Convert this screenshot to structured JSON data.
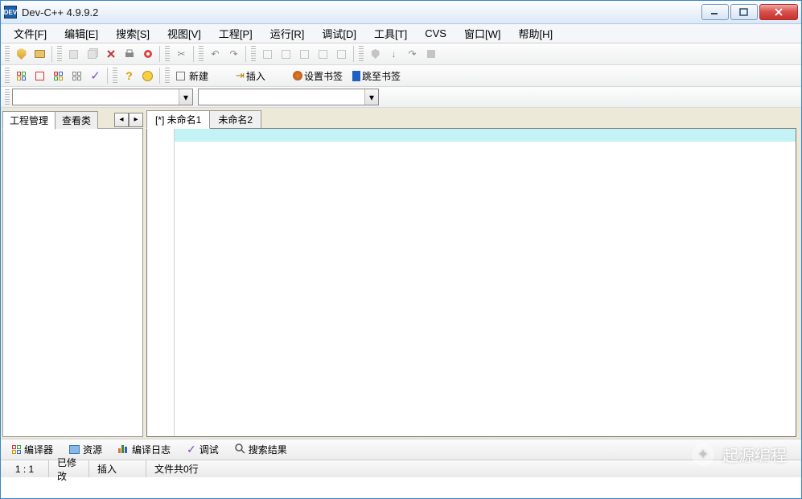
{
  "title": "Dev-C++ 4.9.9.2",
  "menu": [
    "文件[F]",
    "编辑[E]",
    "搜索[S]",
    "视图[V]",
    "工程[P]",
    "运行[R]",
    "调试[D]",
    "工具[T]",
    "CVS",
    "窗口[W]",
    "帮助[H]"
  ],
  "toolbar2": {
    "new_label": "新建",
    "insert_label": "插入",
    "set_bookmark_label": "设置书签",
    "goto_bookmark_label": "跳至书签"
  },
  "panel_tabs": {
    "project_mgmt": "工程管理",
    "class_view": "查看类"
  },
  "editor_tabs": [
    "[*] 未命名1",
    "未命名2"
  ],
  "bottom_tabs": {
    "compiler": "编译器",
    "resources": "资源",
    "compile_log": "编译日志",
    "debug": "调试",
    "search_results": "搜索结果"
  },
  "status": {
    "position": "1 : 1",
    "modified": "已修改",
    "insert_mode": "插入",
    "file_lines": "文件共0行"
  },
  "watermark": "起源编程"
}
